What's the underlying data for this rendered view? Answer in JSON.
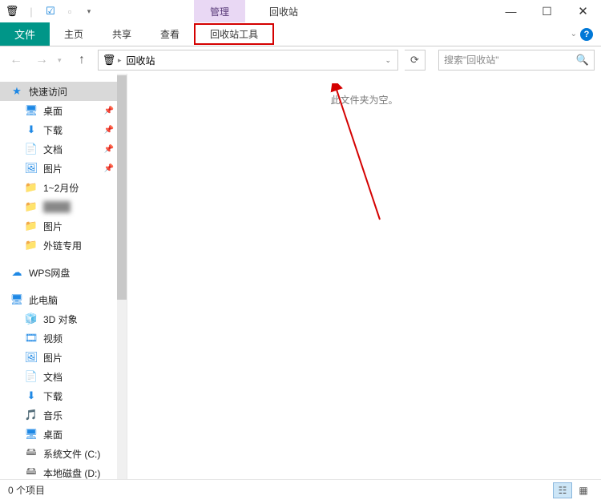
{
  "window": {
    "context_tab": "管理",
    "title": "回收站"
  },
  "ribbon": {
    "file": "文件",
    "tabs": [
      "主页",
      "共享",
      "查看",
      "回收站工具"
    ]
  },
  "nav": {
    "address_location": "回收站",
    "search_placeholder": "搜索\"回收站\""
  },
  "sidebar": {
    "quick_access": "快速访问",
    "quick_items": [
      {
        "label": "桌面",
        "icon": "🖥",
        "pinned": true,
        "color": "#1e88e5"
      },
      {
        "label": "下载",
        "icon": "⬇",
        "pinned": true,
        "color": "#1e88e5"
      },
      {
        "label": "文档",
        "icon": "📄",
        "pinned": true,
        "color": "#1e88e5"
      },
      {
        "label": "图片",
        "icon": "🖼",
        "pinned": true,
        "color": "#1e88e5"
      },
      {
        "label": "1~2月份",
        "icon": "📁",
        "pinned": false,
        "color": "#f5c454"
      },
      {
        "label": "",
        "icon": "📁",
        "pinned": false,
        "color": "#f5c454",
        "blur": true
      },
      {
        "label": "图片",
        "icon": "📁",
        "pinned": false,
        "color": "#f5c454"
      },
      {
        "label": "外链专用",
        "icon": "📁",
        "pinned": false,
        "color": "#f5c454"
      }
    ],
    "wps": "WPS网盘",
    "this_pc": "此电脑",
    "pc_items": [
      {
        "label": "3D 对象",
        "icon": "🧊",
        "color": "#1e88e5"
      },
      {
        "label": "视频",
        "icon": "🎞",
        "color": "#1e88e5"
      },
      {
        "label": "图片",
        "icon": "🖼",
        "color": "#1e88e5"
      },
      {
        "label": "文档",
        "icon": "📄",
        "color": "#1e88e5"
      },
      {
        "label": "下载",
        "icon": "⬇",
        "color": "#1e88e5"
      },
      {
        "label": "音乐",
        "icon": "🎵",
        "color": "#1e88e5"
      },
      {
        "label": "桌面",
        "icon": "🖥",
        "color": "#1e88e5"
      },
      {
        "label": "系统文件 (C:)",
        "icon": "🖴",
        "color": "#777"
      },
      {
        "label": "本地磁盘 (D:)",
        "icon": "🖴",
        "color": "#777"
      }
    ]
  },
  "content": {
    "empty_message": "此文件夹为空。"
  },
  "status": {
    "items_text": "0 个项目"
  }
}
